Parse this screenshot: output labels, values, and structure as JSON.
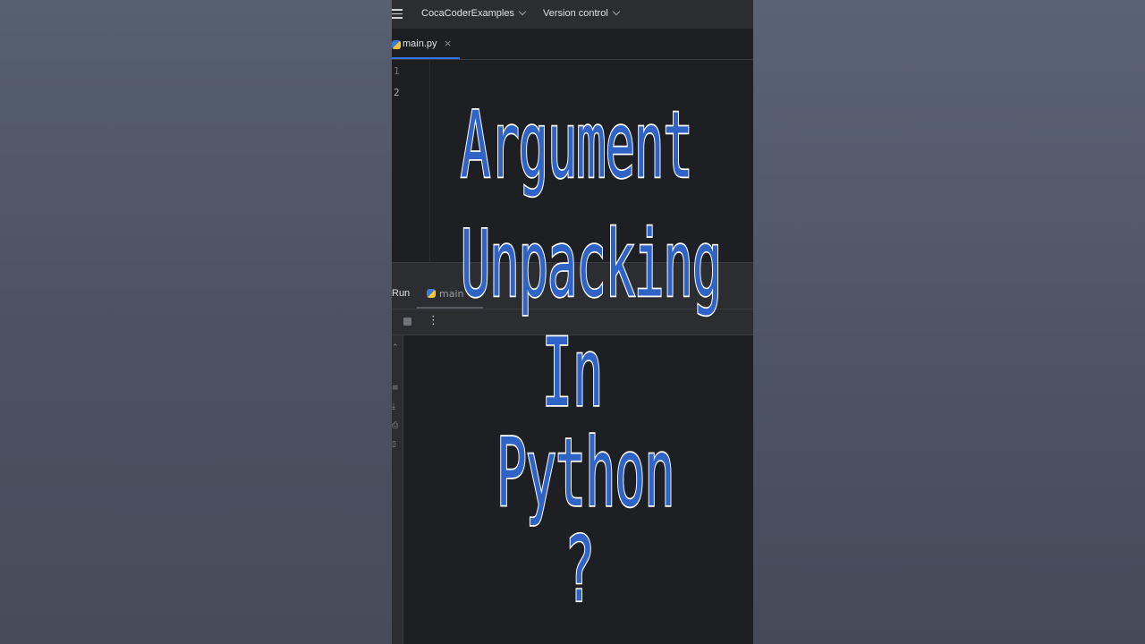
{
  "titlebar": {
    "project": "CocaCoderExamples",
    "vcs": "Version control"
  },
  "editor": {
    "tab_label": "main.py",
    "tab_close": "×",
    "line_numbers": [
      "1",
      "2"
    ]
  },
  "run": {
    "label": "Run",
    "tab_label": "main",
    "more": "⋮"
  },
  "overlay": {
    "line1": "Argument",
    "line2": "Unpacking",
    "line3": "In",
    "line4": "Python",
    "line5": "?"
  },
  "colors": {
    "title_text": "#2f63c6",
    "title_outline": "#ffffff",
    "accent": "#3574f0"
  }
}
